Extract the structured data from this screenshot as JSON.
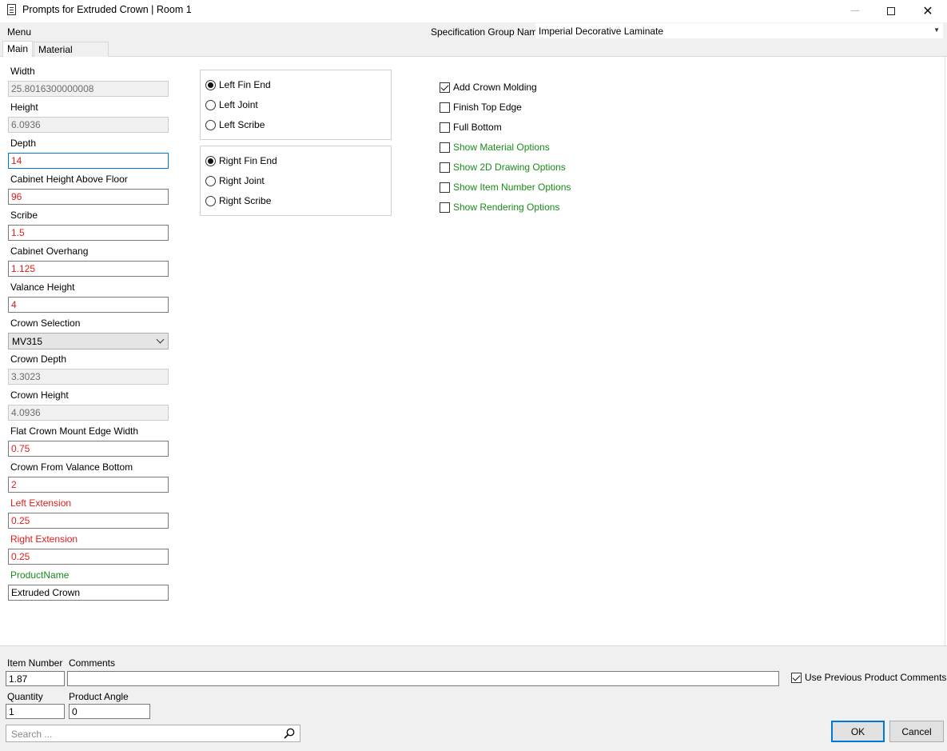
{
  "window": {
    "title": "Prompts for Extruded Crown | Room 1",
    "minimize": "—",
    "maximize": "",
    "close": "✕"
  },
  "menubar": {
    "menu_label": "Menu",
    "spec_label": "Specification Group Name",
    "spec_value": "Imperial Decorative Laminate"
  },
  "tabs": [
    {
      "label": "Main"
    },
    {
      "label": "Material Options"
    }
  ],
  "fields": {
    "width": {
      "label": "Width",
      "value": "25.8016300000008"
    },
    "height": {
      "label": "Height",
      "value": "6.0936"
    },
    "depth": {
      "label": "Depth",
      "value": "14"
    },
    "cab_height": {
      "label": "Cabinet Height Above Floor",
      "value": "96"
    },
    "scribe": {
      "label": "Scribe",
      "value": "1.5"
    },
    "overhang": {
      "label": "Cabinet Overhang",
      "value": "1.125"
    },
    "valance": {
      "label": "Valance Height",
      "value": "4"
    },
    "crown_sel": {
      "label": "Crown Selection",
      "value": "MV315"
    },
    "crown_depth": {
      "label": "Crown Depth",
      "value": "3.3023"
    },
    "crown_height": {
      "label": "Crown Height",
      "value": "4.0936"
    },
    "flat_edge": {
      "label": "Flat Crown Mount Edge Width",
      "value": "0.75"
    },
    "from_valance": {
      "label": "Crown From Valance Bottom",
      "value": "2"
    },
    "left_ext": {
      "label": "Left Extension",
      "value": "0.25"
    },
    "right_ext": {
      "label": "Right Extension",
      "value": "0.25"
    },
    "product_name": {
      "label": "ProductName",
      "value": "Extruded Crown"
    }
  },
  "left_group": {
    "options": [
      "Left Fin End",
      "Left Joint",
      "Left Scribe"
    ],
    "selected": "Left Fin End"
  },
  "right_group": {
    "options": [
      "Right Fin End",
      "Right Joint",
      "Right Scribe"
    ],
    "selected": "Right Fin End"
  },
  "checkboxes": [
    {
      "label": "Add Crown Molding",
      "checked": true
    },
    {
      "label": "Finish Top Edge",
      "checked": false
    },
    {
      "label": "Full Bottom",
      "checked": false
    },
    {
      "label": "Show Material Options",
      "checked": false
    },
    {
      "label": "Show 2D Drawing Options",
      "checked": false
    },
    {
      "label": "Show Item Number Options",
      "checked": false
    },
    {
      "label": "Show Rendering Options",
      "checked": false
    }
  ],
  "bottom": {
    "item_number_label": "Item Number",
    "item_number": "1.87",
    "comments_label": "Comments",
    "comments": "",
    "use_prev_label": "Use Previous Product Comments",
    "quantity_label": "Quantity",
    "quantity": "1",
    "angle_label": "Product Angle",
    "angle": "0",
    "search_placeholder": "Search ...",
    "ok_label": "OK",
    "cancel_label": "Cancel"
  },
  "colors": {
    "required": "#e21b1b",
    "option_link": "#1a8a1a",
    "focus": "#0078d7"
  }
}
